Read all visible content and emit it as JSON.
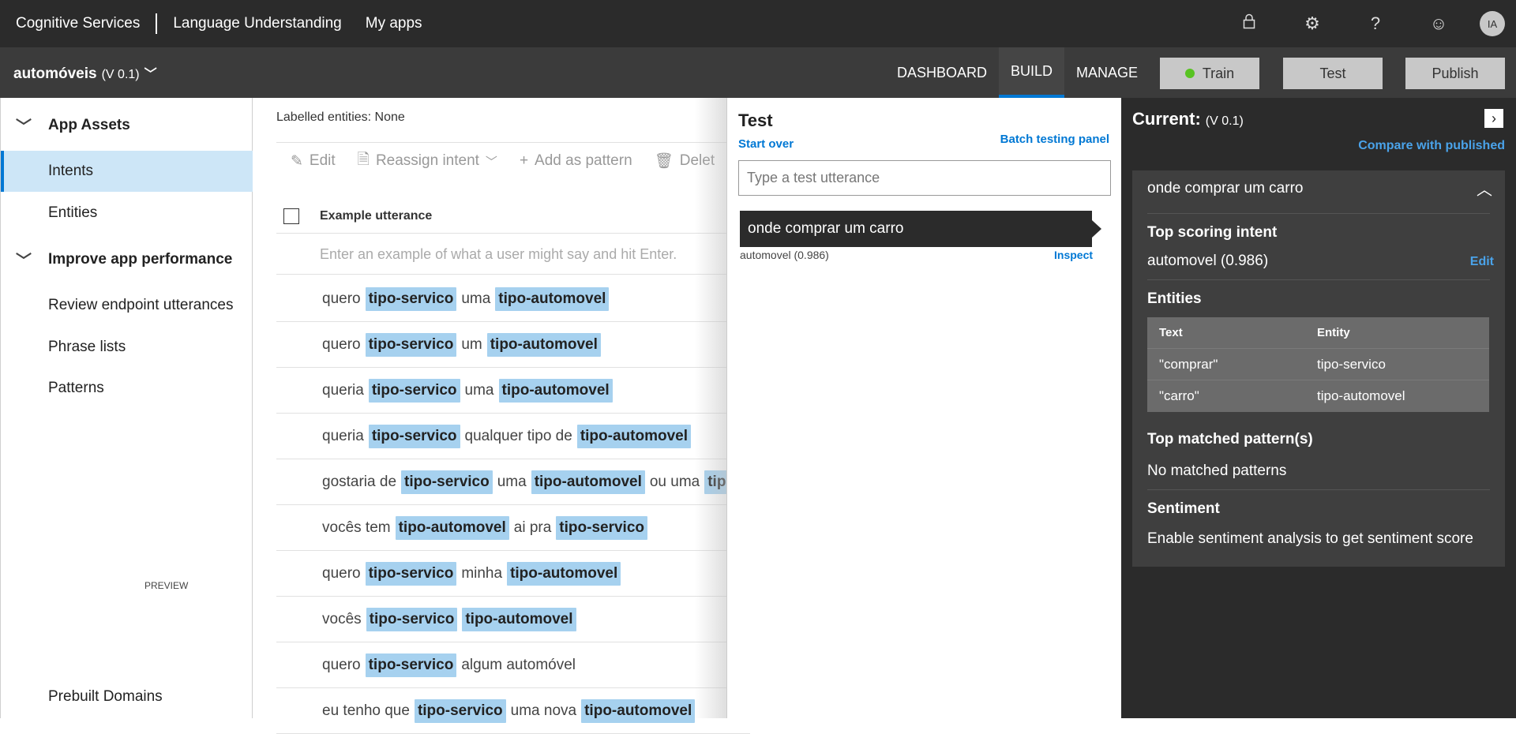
{
  "topbar": {
    "brand": "Cognitive Services",
    "product": "Language Understanding",
    "my_apps": "My apps",
    "icons": [
      "lock-icon",
      "gear-icon",
      "help-icon",
      "smiley-icon"
    ],
    "avatar_initials": "IA"
  },
  "appbar": {
    "app_name": "automóveis",
    "version": "(V 0.1)",
    "tabs": [
      "DASHBOARD",
      "BUILD",
      "MANAGE"
    ],
    "active_tab": "BUILD",
    "train": "Train",
    "test": "Test",
    "publish": "Publish"
  },
  "sidebar": {
    "group1": "App Assets",
    "intents": "Intents",
    "entities": "Entities",
    "group2": "Improve app performance",
    "review": "Review endpoint utterances",
    "phrase_lists": "Phrase lists",
    "patterns": "Patterns",
    "prebuilt": "Prebuilt Domains",
    "preview": "PREVIEW"
  },
  "main": {
    "labelled": "Labelled entities: None",
    "toolbar": {
      "edit": "Edit",
      "reassign": "Reassign intent",
      "add_pattern": "Add as pattern",
      "delete": "Delet"
    },
    "column_header": "Example utterance",
    "placeholder": "Enter an example of what a user might say and hit Enter.",
    "rows": [
      [
        {
          "t": "quero"
        },
        {
          "e": "tipo-servico"
        },
        {
          "t": "uma"
        },
        {
          "e": "tipo-automovel"
        }
      ],
      [
        {
          "t": "quero"
        },
        {
          "e": "tipo-servico"
        },
        {
          "t": "um"
        },
        {
          "e": "tipo-automovel"
        }
      ],
      [
        {
          "t": "queria"
        },
        {
          "e": "tipo-servico"
        },
        {
          "t": "uma"
        },
        {
          "e": "tipo-automovel"
        }
      ],
      [
        {
          "t": "queria"
        },
        {
          "e": "tipo-servico"
        },
        {
          "t": "qualquer tipo de"
        },
        {
          "e": "tipo-automovel"
        }
      ],
      [
        {
          "t": "gostaria de"
        },
        {
          "e": "tipo-servico"
        },
        {
          "t": "uma"
        },
        {
          "e": "tipo-automovel"
        },
        {
          "t": "ou uma"
        },
        {
          "e": "tipo"
        }
      ],
      [
        {
          "t": "vocês tem"
        },
        {
          "e": "tipo-automovel"
        },
        {
          "t": "ai pra"
        },
        {
          "e": "tipo-servico"
        }
      ],
      [
        {
          "t": "quero"
        },
        {
          "e": "tipo-servico"
        },
        {
          "t": "minha"
        },
        {
          "e": "tipo-automovel"
        }
      ],
      [
        {
          "t": "vocês"
        },
        {
          "e": "tipo-servico"
        },
        {
          "e": "tipo-automovel"
        }
      ],
      [
        {
          "t": "quero"
        },
        {
          "e": "tipo-servico"
        },
        {
          "t": "algum automóvel"
        }
      ],
      [
        {
          "t": "eu tenho que"
        },
        {
          "e": "tipo-servico"
        },
        {
          "t": "uma nova"
        },
        {
          "e": "tipo-automovel"
        }
      ]
    ]
  },
  "test_panel": {
    "title": "Test",
    "start_over": "Start over",
    "batch": "Batch testing panel",
    "input_placeholder": "Type a test utterance",
    "result_utterance": "onde comprar um carro",
    "result_score": "automovel (0.986)",
    "inspect": "Inspect"
  },
  "inspect_panel": {
    "current_label": "Current:",
    "version": "(V 0.1)",
    "compare": "Compare with published",
    "utterance": "onde comprar um carro",
    "top_intent_heading": "Top scoring intent",
    "top_intent": "automovel (0.986)",
    "edit": "Edit",
    "entities_heading": "Entities",
    "entities_table": {
      "headers": [
        "Text",
        "Entity"
      ],
      "rows": [
        [
          "\"comprar\"",
          "tipo-servico"
        ],
        [
          "\"carro\"",
          "tipo-automovel"
        ]
      ]
    },
    "patterns_heading": "Top matched pattern(s)",
    "patterns_text": "No matched patterns",
    "sentiment_heading": "Sentiment",
    "sentiment_text": "Enable sentiment analysis to get sentiment score"
  }
}
